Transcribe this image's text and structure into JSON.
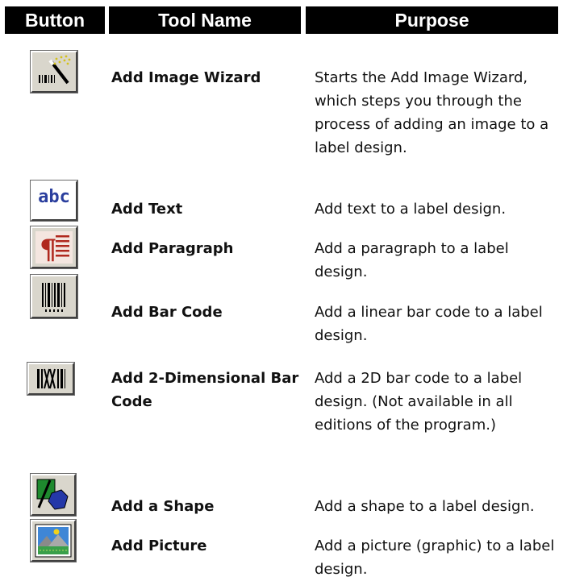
{
  "header": {
    "button": "Button",
    "tool_name": "Tool Name",
    "purpose": "Purpose"
  },
  "rows": [
    {
      "icon": "magic-wand-icon",
      "tool": "Add Image Wizard",
      "purpose": "Starts the Add Image Wizard, which steps you through the process of adding an image to a label design."
    },
    {
      "icon": "abc-text-icon",
      "icon_text": "abc",
      "tool": "Add Text",
      "purpose": "Add text to a label design."
    },
    {
      "icon": "paragraph-icon",
      "tool": "Add Paragraph",
      "purpose": "Add a paragraph to a label design."
    },
    {
      "icon": "barcode-icon",
      "tool": "Add Bar Code",
      "purpose": "Add a linear bar code to a label design."
    },
    {
      "icon": "2d-barcode-icon",
      "tool": "Add 2-Dimensional Bar Code",
      "purpose": "Add a 2D bar code to a label design. (Not available in all editions of the program.)"
    },
    {
      "icon": "shape-icon",
      "tool": "Add a Shape",
      "purpose": "Add a shape to a label design."
    },
    {
      "icon": "picture-icon",
      "tool": "Add Picture",
      "purpose": "Add a picture (graphic) to a label design."
    }
  ],
  "colors": {
    "header_bg": "#000000",
    "header_text": "#ffffff",
    "icon_face": "#d9d6cc",
    "abc_blue": "#2b3f9e",
    "paragraph_red": "#b0281e"
  }
}
